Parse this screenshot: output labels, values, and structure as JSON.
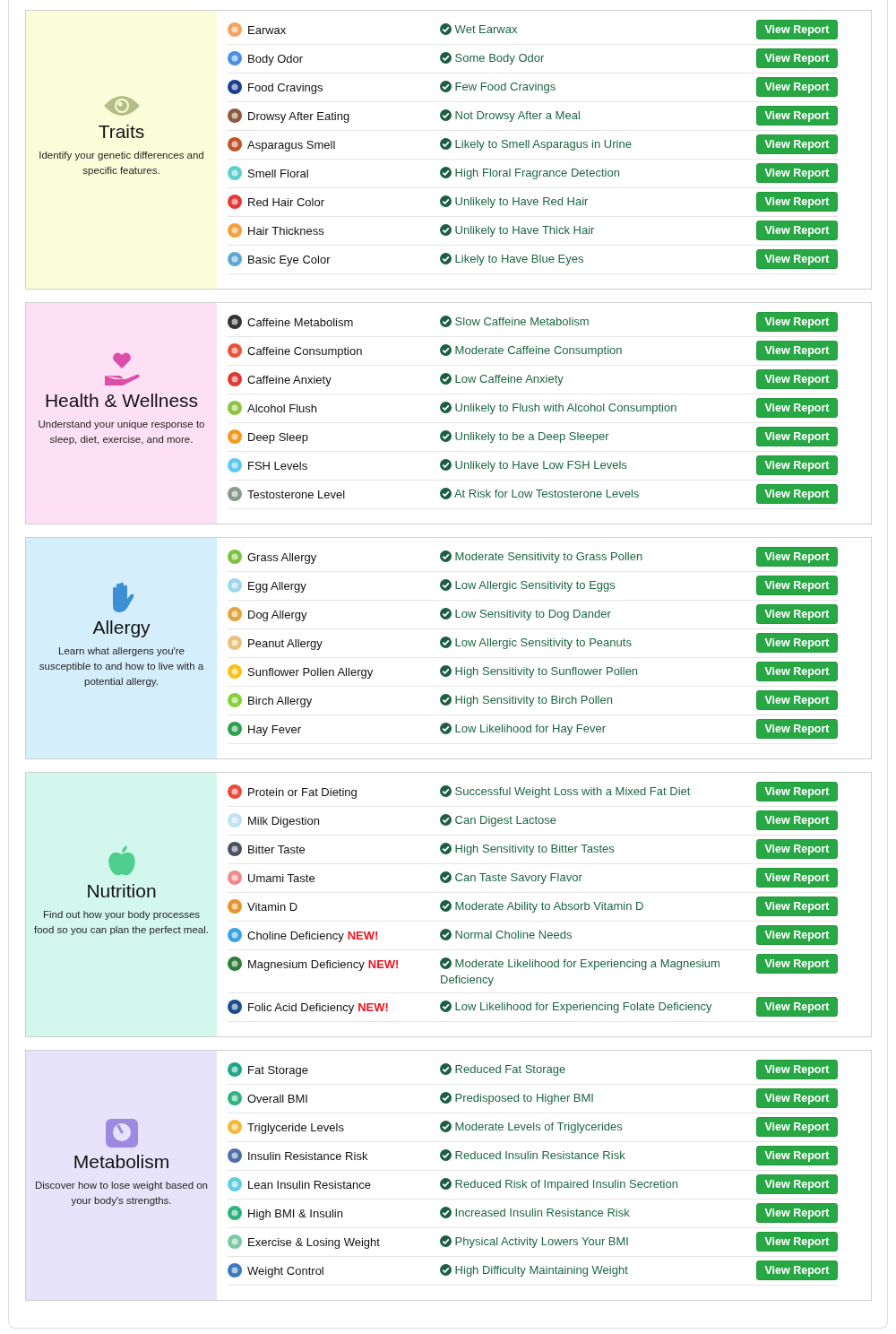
{
  "sections": [
    {
      "kind": "eye",
      "color": "#fbfdd9",
      "title": "Traits",
      "description": "Identify your genetic differences and specific features.",
      "items": [
        {
          "name": "Earwax",
          "color": "#f5a25d",
          "result": "Wet Earwax",
          "button": "View Report"
        },
        {
          "name": "Body Odor",
          "color": "#4a90e2",
          "result": "Some Body Odor",
          "button": "View Report"
        },
        {
          "name": "Food Cravings",
          "color": "#1d3f8f",
          "result": "Few Food Cravings",
          "button": "View Report"
        },
        {
          "name": "Drowsy After Eating",
          "color": "#8b5a3c",
          "result": "Not Drowsy After a Meal",
          "button": "View Report"
        },
        {
          "name": "Asparagus Smell",
          "color": "#c0552a",
          "result": "Likely to Smell Asparagus in Urine",
          "button": "View Report"
        },
        {
          "name": "Smell Floral",
          "color": "#5fcfcf",
          "result": "High Floral Fragrance Detection",
          "button": "View Report"
        },
        {
          "name": "Red Hair Color",
          "color": "#e53935",
          "result": "Unlikely to Have Red Hair",
          "button": "View Report"
        },
        {
          "name": "Hair Thickness",
          "color": "#f6a03a",
          "result": "Unlikely to Have Thick Hair",
          "button": "View Report"
        },
        {
          "name": "Basic Eye Color",
          "color": "#5fa8d3",
          "result": "Likely to Have Blue Eyes",
          "button": "View Report"
        }
      ]
    },
    {
      "kind": "heart",
      "color": "#fde0f6",
      "title": "Health & Wellness",
      "description": "Understand your unique response to sleep, diet, exercise, and more.",
      "items": [
        {
          "name": "Caffeine Metabolism",
          "color": "#333333",
          "result": "Slow Caffeine Metabolism",
          "button": "View Report"
        },
        {
          "name": "Caffeine Consumption",
          "color": "#e8533a",
          "result": "Moderate Caffeine Consumption",
          "button": "View Report"
        },
        {
          "name": "Caffeine Anxiety",
          "color": "#d93a32",
          "result": "Low Caffeine Anxiety",
          "button": "View Report"
        },
        {
          "name": "Alcohol Flush",
          "color": "#8cc43f",
          "result": "Unlikely to Flush with Alcohol Consumption",
          "button": "View Report"
        },
        {
          "name": "Deep Sleep",
          "color": "#f39a1e",
          "result": "Unlikely to be a Deep Sleeper",
          "button": "View Report"
        },
        {
          "name": "FSH Levels",
          "color": "#5bc8f5",
          "result": "Unlikely to Have Low FSH Levels",
          "button": "View Report"
        },
        {
          "name": "Testosterone Level",
          "color": "#8a9a8a",
          "result": "At Risk for Low Testosterone Levels",
          "button": "View Report"
        }
      ]
    },
    {
      "kind": "hand",
      "color": "#d5eefb",
      "title": "Allergy",
      "description": "Learn what allergens you're susceptible to and how to live with a potential allergy.",
      "items": [
        {
          "name": "Grass Allergy",
          "color": "#7cc242",
          "result": "Moderate Sensitivity to Grass Pollen",
          "button": "View Report"
        },
        {
          "name": "Egg Allergy",
          "color": "#9fd6ee",
          "result": "Low Allergic Sensitivity to Eggs",
          "button": "View Report"
        },
        {
          "name": "Dog Allergy",
          "color": "#e0a640",
          "result": "Low Sensitivity to Dog Dander",
          "button": "View Report"
        },
        {
          "name": "Peanut Allergy",
          "color": "#e8c27a",
          "result": "Low Allergic Sensitivity to Peanuts",
          "button": "View Report"
        },
        {
          "name": "Sunflower Pollen Allergy",
          "color": "#f7c21a",
          "result": "High Sensitivity to Sunflower Pollen",
          "button": "View Report"
        },
        {
          "name": "Birch Allergy",
          "color": "#86d13a",
          "result": "High Sensitivity to Birch Pollen",
          "button": "View Report"
        },
        {
          "name": "Hay Fever",
          "color": "#2e9e4f",
          "result": "Low Likelihood for Hay Fever",
          "button": "View Report"
        }
      ]
    },
    {
      "kind": "apple",
      "color": "#d3f7ec",
      "title": "Nutrition",
      "description": "Find out how your body processes food so you can plan the perfect meal.",
      "items": [
        {
          "name": "Protein or Fat Dieting",
          "color": "#e84c3d",
          "result": "Successful Weight Loss with a Mixed Fat Diet",
          "button": "View Report"
        },
        {
          "name": "Milk Digestion",
          "color": "#bfe3f5",
          "result": "Can Digest Lactose",
          "button": "View Report"
        },
        {
          "name": "Bitter Taste",
          "color": "#4a5060",
          "result": "High Sensitivity to Bitter Tastes",
          "button": "View Report"
        },
        {
          "name": "Umami Taste",
          "color": "#f08a8a",
          "result": "Can Taste Savory Flavor",
          "button": "View Report"
        },
        {
          "name": "Vitamin D",
          "color": "#e5932a",
          "result": "Moderate Ability to Absorb Vitamin D",
          "button": "View Report"
        },
        {
          "name": "Choline Deficiency",
          "badge": "NEW!",
          "color": "#3aa3e3",
          "result": "Normal Choline Needs",
          "button": "View Report"
        },
        {
          "name": "Magnesium Deficiency",
          "badge": "NEW!",
          "color": "#2f7d3b",
          "result": "Moderate Likelihood for Experiencing a Magnesium Deficiency",
          "button": "View Report"
        },
        {
          "name": "Folic Acid Deficiency",
          "badge": "NEW!",
          "color": "#1c4c8c",
          "result": "Low Likelihood for Experiencing Folate Deficiency",
          "button": "View Report"
        }
      ]
    },
    {
      "kind": "scale",
      "color": "#e6e3fa",
      "title": "Metabolism",
      "description": "Discover how to lose weight based on your body's strengths.",
      "items": [
        {
          "name": "Fat Storage",
          "color": "#1fa58a",
          "result": "Reduced Fat Storage",
          "button": "View Report"
        },
        {
          "name": "Overall BMI",
          "color": "#2eb37e",
          "result": "Predisposed to Higher BMI",
          "button": "View Report"
        },
        {
          "name": "Triglyceride Levels",
          "color": "#f2b93b",
          "result": "Moderate Levels of Triglycerides",
          "button": "View Report"
        },
        {
          "name": "Insulin Resistance Risk",
          "color": "#4d6fa8",
          "result": "Reduced Insulin Resistance Risk",
          "button": "View Report"
        },
        {
          "name": "Lean Insulin Resistance",
          "color": "#5fd0e0",
          "result": "Reduced Risk of Impaired Insulin Secretion",
          "button": "View Report"
        },
        {
          "name": "High BMI & Insulin",
          "color": "#2eb37e",
          "result": "Increased Insulin Resistance Risk",
          "button": "View Report"
        },
        {
          "name": "Exercise & Losing Weight",
          "color": "#7fc9a0",
          "result": "Physical Activity Lowers Your BMI",
          "button": "View Report"
        },
        {
          "name": "Weight Control",
          "color": "#3a78c0",
          "result": "High Difficulty Maintaining Weight",
          "button": "View Report"
        }
      ]
    }
  ]
}
